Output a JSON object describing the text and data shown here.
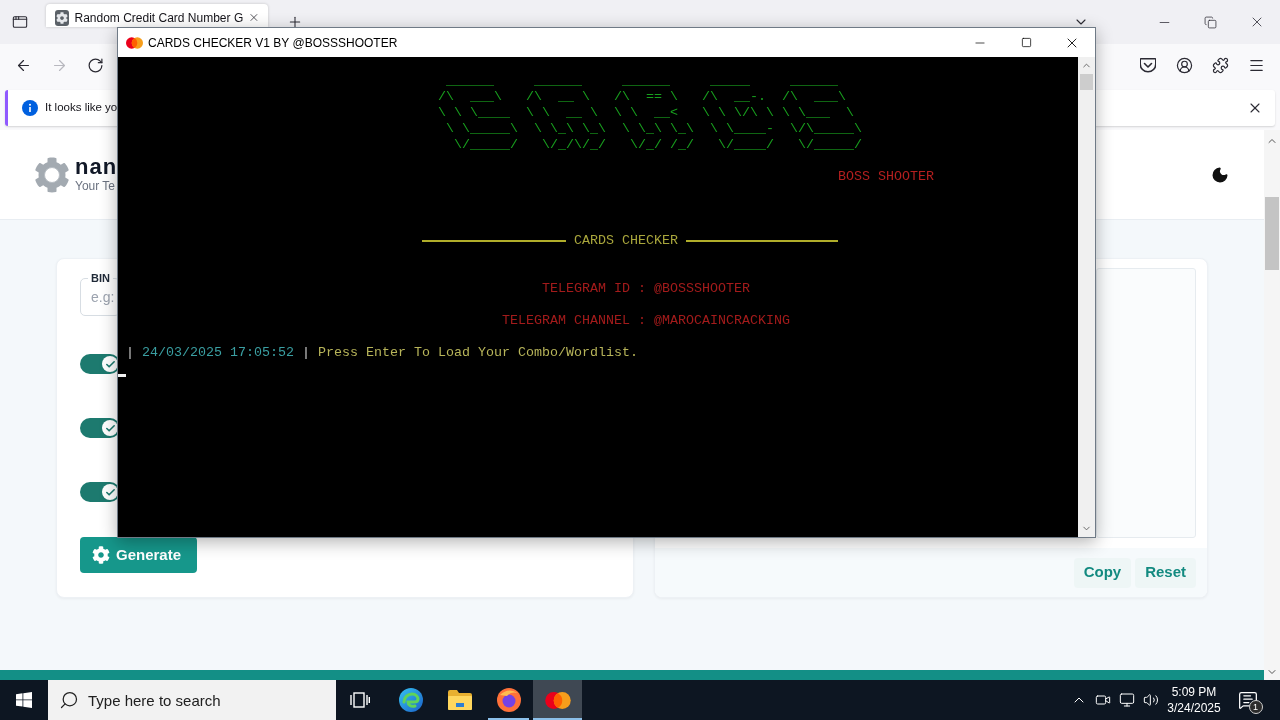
{
  "browser": {
    "tabs": [
      {
        "title": "Random Credit Card Number G",
        "selected": true
      }
    ],
    "nav_buttons": [
      {
        "kind": "back",
        "disabled": false
      },
      {
        "kind": "forward",
        "disabled": true
      },
      {
        "kind": "reload",
        "disabled": false
      }
    ],
    "notification": {
      "text": "It looks like yo"
    }
  },
  "page": {
    "brand": {
      "name": "nan",
      "tagline": "Your Te"
    },
    "generator": {
      "bin_label": "BIN",
      "bin_placeholder": "e.g:",
      "toggles": [
        {
          "on": true
        },
        {
          "on": true
        },
        {
          "on": true
        }
      ],
      "generate_button": "Generate"
    },
    "output": {
      "buttons": [
        "Copy",
        "Reset"
      ]
    }
  },
  "console": {
    "title": "CARDS CHECKER V1 BY @BOSSSHOOTER",
    "banner_art": [
      " ______     ______     ______     _____     ______",
      "/\\  ___\\   /\\  __ \\   /\\  == \\   /\\  __-.  /\\  ___\\",
      "\\ \\ \\____  \\ \\  __ \\  \\ \\  __<   \\ \\ \\/\\ \\ \\ \\___  \\",
      " \\ \\_____\\  \\ \\_\\ \\_\\  \\ \\_\\ \\_\\  \\ \\____-  \\/\\_____\\",
      "  \\/_____/   \\/_/\\/_/   \\/_/ /_/   \\/____/   \\/_____/"
    ],
    "author": "BOSS SHOOTER",
    "heading": "CARDS CHECKER",
    "telegram_id": "TELEGRAM ID : @BOSSSHOOTER",
    "telegram_channel": "TELEGRAM CHANNEL : @MAROCAINCRACKING",
    "log_line": {
      "prefix": "|",
      "timestamp": "24/03/2025 17:05:52",
      "separator": "|",
      "message": "Press Enter To Load Your Combo/Wordlist."
    }
  },
  "taskbar": {
    "search_placeholder": "Type here to search",
    "apps": [
      {
        "kind": "swirl",
        "running": false,
        "selected": false
      },
      {
        "kind": "folder",
        "running": false,
        "selected": false
      },
      {
        "kind": "fox",
        "running": true,
        "selected": false
      },
      {
        "kind": "circles",
        "running": true,
        "selected": true
      }
    ],
    "time": "5:09 PM",
    "date": "3/24/2025",
    "notification_badge": "1"
  }
}
